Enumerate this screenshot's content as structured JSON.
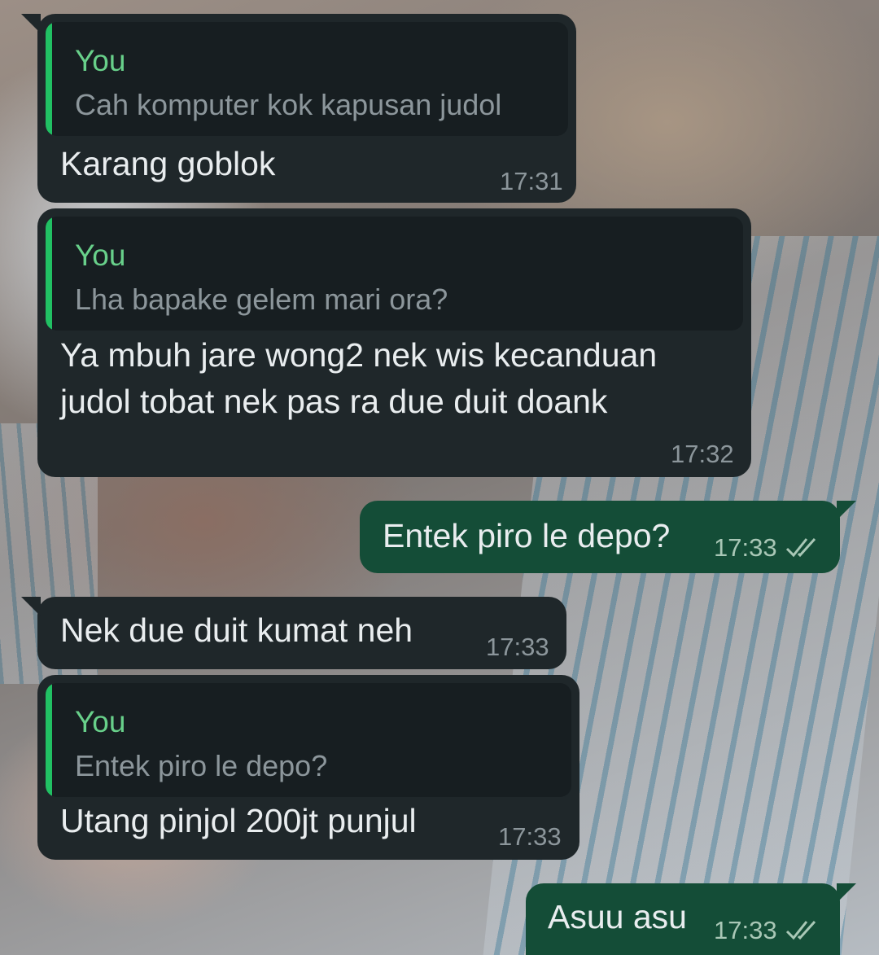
{
  "messages": [
    {
      "direction": "incoming",
      "quote": {
        "name": "You",
        "text": "Cah komputer kok kapusan judol"
      },
      "text": "Karang goblok",
      "time": "17:31"
    },
    {
      "direction": "incoming",
      "quote": {
        "name": "You",
        "text": "Lha bapake gelem mari ora?"
      },
      "text_lines": [
        "Ya mbuh jare wong2 nek wis kecanduan",
        "judol tobat nek pas ra due duit doank"
      ],
      "time": "17:32"
    },
    {
      "direction": "outgoing",
      "text": "Entek piro le depo?",
      "time": "17:33",
      "status": "read-ticks-icon"
    },
    {
      "direction": "incoming",
      "text": "Nek due duit kumat neh",
      "time": "17:33"
    },
    {
      "direction": "incoming",
      "quote": {
        "name": "You",
        "text": "Entek piro le depo?"
      },
      "text": "Utang pinjol 200jt punjul",
      "time": "17:33"
    },
    {
      "direction": "outgoing",
      "text": "Asuu asu",
      "time": "17:33",
      "status": "read-ticks-icon"
    }
  ],
  "colors": {
    "incoming_bubble": "#1f272a",
    "outgoing_bubble": "#144d37",
    "quote_background": "#171e21",
    "quote_bar": "#21c063",
    "quote_name": "#68d08a",
    "timestamp": "#8c969b"
  }
}
